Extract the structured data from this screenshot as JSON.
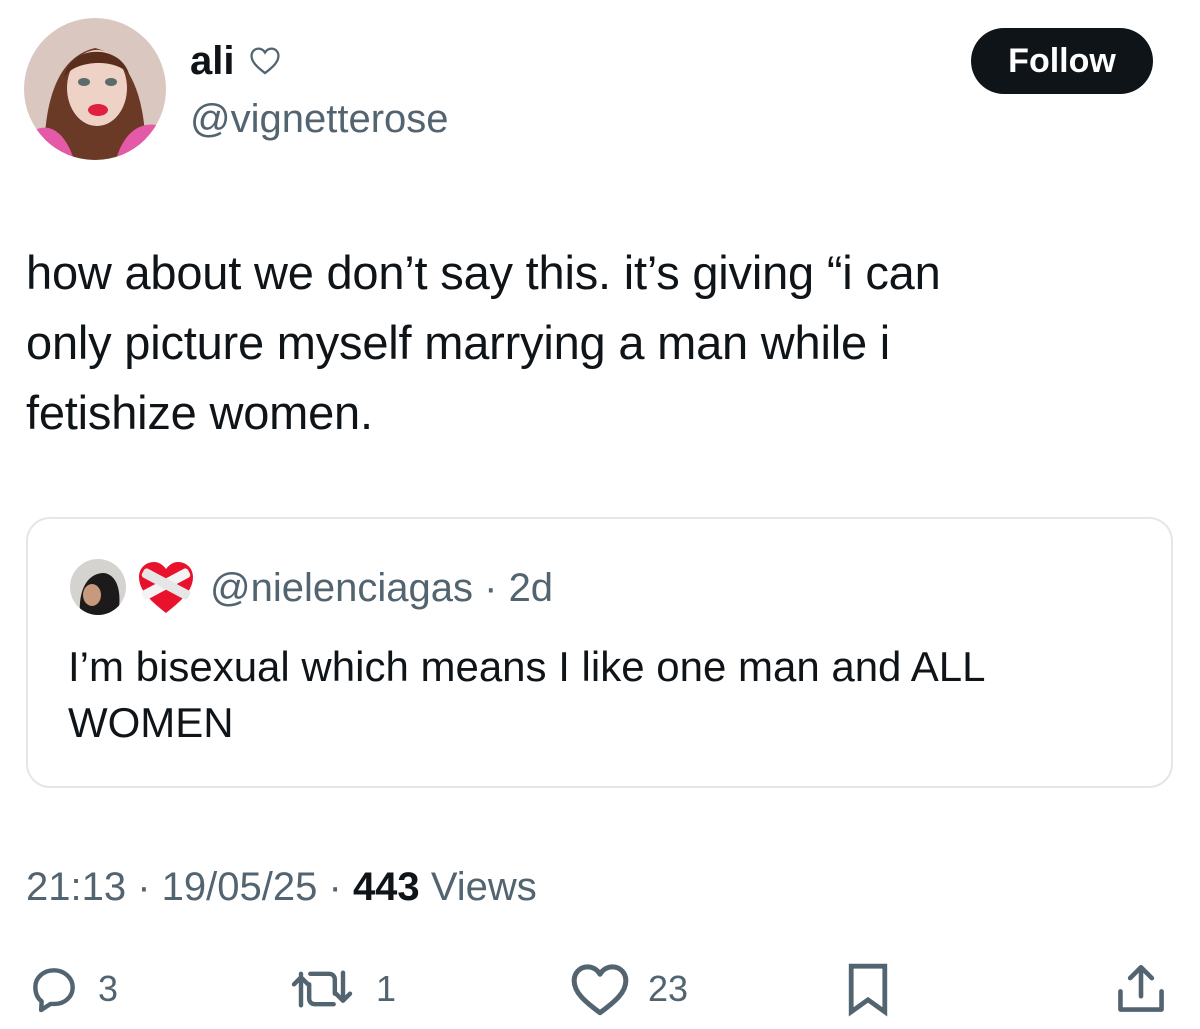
{
  "author": {
    "display_name": "ali",
    "handle": "@vignetterose",
    "avatar_icon": "profile-photo",
    "name_badge_icon": "white-heart-icon"
  },
  "follow_button": {
    "label": "Follow"
  },
  "tweet": {
    "text": "how about we don’t say this. it’s giving “i can\nonly picture myself marrying a man while i\nfetishize women."
  },
  "quoted_tweet": {
    "handle": "@nielenciagas",
    "separator": "·",
    "age": "2d",
    "avatar_icon": "profile-photo",
    "badge_icon": "mending-heart-emoji",
    "text": "I’m bisexual which means I like one man and ALL\nWOMEN"
  },
  "meta": {
    "time": "21:13",
    "date": "19/05/25",
    "views_count": "443",
    "views_label": "Views",
    "separator": "·"
  },
  "actions": {
    "replies": "3",
    "reposts": "1",
    "likes": "23"
  },
  "colors": {
    "text_primary": "#0f1419",
    "text_secondary": "#536471",
    "border": "#e4e7ea",
    "follow_bg": "#0f1419",
    "follow_text": "#ffffff"
  }
}
